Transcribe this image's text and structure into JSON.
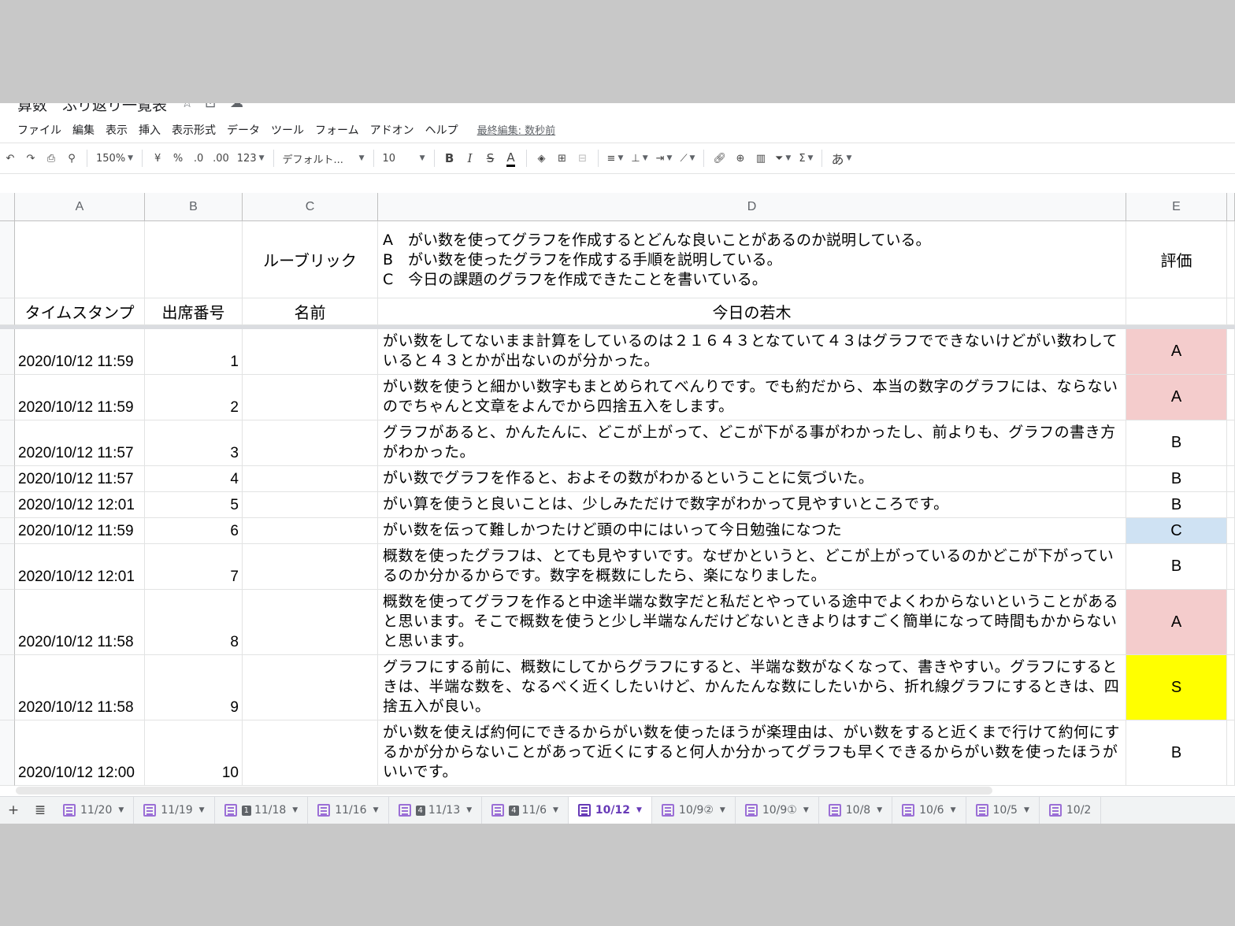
{
  "title": "算数　ふり返り一覧表",
  "menu": [
    "ファイル",
    "編集",
    "表示",
    "挿入",
    "表示形式",
    "データ",
    "ツール",
    "フォーム",
    "アドオン",
    "ヘルプ"
  ],
  "last_edit": "最終編集: 数秒前",
  "toolbar": {
    "zoom": "150%",
    "currency": "¥",
    "percent": "%",
    "dec_decrease": ".0",
    "dec_increase": ".00",
    "number_format": "123",
    "font": "デフォルト...",
    "font_size": "10",
    "bold": "B",
    "italic": "I",
    "strike": "S",
    "text_color": "A",
    "input_tool": "あ"
  },
  "columns": [
    "A",
    "B",
    "C",
    "D",
    "E"
  ],
  "header": {
    "rubric_label": "ルーブリック",
    "rubric_lines": [
      "A　がい数を使ってグラフを作成するとどんな良いことがあるのか説明している。",
      "B　がい数を使ったグラフを作成する手順を説明している。",
      "C　今日の課題のグラフを作成できたことを書いている。"
    ],
    "evaluation_label": "評価",
    "col_timestamp": "タイムスタンプ",
    "col_number": "出席番号",
    "col_name": "名前",
    "col_reflection": "今日の若木"
  },
  "rows": [
    {
      "timestamp": "2020/10/12 11:59",
      "number": "1",
      "name": "",
      "text": "がい数をしてないまま計算をしているのは２１６４３となていて４３はグラフでできないけどがい数わしていると４３とかが出ないのが分かった。",
      "grade": "A"
    },
    {
      "timestamp": "2020/10/12 11:59",
      "number": "2",
      "name": "",
      "text": "がい数を使うと細かい数字もまとめられてべんりです。でも約だから、本当の数字のグラフには、ならないのでちゃんと文章をよんでから四捨五入をします。",
      "grade": "A"
    },
    {
      "timestamp": "2020/10/12 11:57",
      "number": "3",
      "name": "",
      "text": "グラフがあると、かんたんに、どこが上がって、どこが下がる事がわかったし、前よりも、グラフの書き方がわかった。",
      "grade": "B"
    },
    {
      "timestamp": "2020/10/12 11:57",
      "number": "4",
      "name": "",
      "text": "がい数でグラフを作ると、およその数がわかるということに気づいた。",
      "grade": "B"
    },
    {
      "timestamp": "2020/10/12 12:01",
      "number": "5",
      "name": "",
      "text": "がい算を使うと良いことは、少しみただけで数字がわかって見やすいところです。",
      "grade": "B"
    },
    {
      "timestamp": "2020/10/12 11:59",
      "number": "6",
      "name": "",
      "text": "がい数を伝って難しかつたけど頭の中にはいって今日勉強になつた",
      "grade": "C"
    },
    {
      "timestamp": "2020/10/12 12:01",
      "number": "7",
      "name": "",
      "text": "概数を使ったグラフは、とても見やすいです。なぜかというと、どこが上がっているのかどこが下がっているのか分かるからです。数字を概数にしたら、楽になりました。",
      "grade": "B"
    },
    {
      "timestamp": "2020/10/12 11:58",
      "number": "8",
      "name": "",
      "text": "概数を使ってグラフを作ると中途半端な数字だと私だとやっている途中でよくわからないということがあると思います。そこで概数を使うと少し半端なんだけどないときよりはすごく簡単になって時間もかからないと思います。",
      "grade": "A"
    },
    {
      "timestamp": "2020/10/12 11:58",
      "number": "9",
      "name": "",
      "text": "グラフにする前に、概数にしてからグラフにすると、半端な数がなくなって、書きやすい。グラフにするときは、半端な数を、なるべく近くしたいけど、かんたんな数にしたいから、折れ線グラフにするときは、四捨五入が良い。",
      "grade": "S"
    },
    {
      "timestamp": "2020/10/12 12:00",
      "number": "10",
      "name": "",
      "text": "がい数を使えば約何にできるからがい数を使ったほうが楽理由は、がい数をすると近くまで行けて約何にするかが分からないことがあって近くにすると何人か分かってグラフも早くできるからがい数を使ったほうがいいです。",
      "grade": "B"
    }
  ],
  "grade_colors": {
    "A": "#f4cccc",
    "B": "#ffffff",
    "C": "#cfe2f3",
    "S": "#ffff00"
  },
  "sheet_tabs": [
    {
      "label": "11/20",
      "badge": "",
      "active": false
    },
    {
      "label": "11/19",
      "badge": "",
      "active": false
    },
    {
      "label": "11/18",
      "badge": "1",
      "active": false
    },
    {
      "label": "11/16",
      "badge": "",
      "active": false
    },
    {
      "label": "11/13",
      "badge": "4",
      "active": false
    },
    {
      "label": "11/6",
      "badge": "4",
      "active": false
    },
    {
      "label": "10/12",
      "badge": "",
      "active": true
    },
    {
      "label": "10/9②",
      "badge": "",
      "active": false
    },
    {
      "label": "10/9①",
      "badge": "",
      "active": false
    },
    {
      "label": "10/8",
      "badge": "",
      "active": false
    },
    {
      "label": "10/6",
      "badge": "",
      "active": false
    },
    {
      "label": "10/5",
      "badge": "",
      "active": false
    },
    {
      "label": "10/2",
      "badge": "",
      "active": false
    }
  ]
}
